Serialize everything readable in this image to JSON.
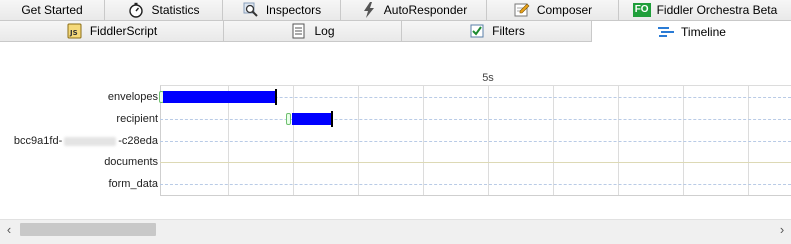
{
  "tabs_row1": [
    {
      "label": "Get Started",
      "icon": "none"
    },
    {
      "label": "Statistics",
      "icon": "stopwatch-icon"
    },
    {
      "label": "Inspectors",
      "icon": "magnifier-icon"
    },
    {
      "label": "AutoResponder",
      "icon": "lightning-icon"
    },
    {
      "label": "Composer",
      "icon": "pencil-icon"
    },
    {
      "label": "Fiddler Orchestra Beta",
      "icon": "fo-badge",
      "badge": "FO"
    }
  ],
  "tabs_row2": [
    {
      "label": "FiddlerScript",
      "icon": "script-icon"
    },
    {
      "label": "Log",
      "icon": "log-icon"
    },
    {
      "label": "Filters",
      "icon": "checkbox-icon"
    },
    {
      "label": "Timeline",
      "icon": "timeline-icon",
      "active": true
    }
  ],
  "timeline": {
    "axis_label": "5s",
    "rows": [
      {
        "label": "envelopes"
      },
      {
        "label": "recipient"
      },
      {
        "label_prefix": "bcc9a1fd-",
        "label_suffix": "-c28eda"
      },
      {
        "label": "documents"
      },
      {
        "label": "form_data"
      }
    ]
  },
  "colors": {
    "bar": "#0000ff",
    "row_dashed": "#b9cbe6",
    "row_solid": "#ddd9b5",
    "fo_badge": "#1f9e3a"
  },
  "scrollbar": {
    "left_arrow": "‹",
    "right_arrow": "›"
  }
}
